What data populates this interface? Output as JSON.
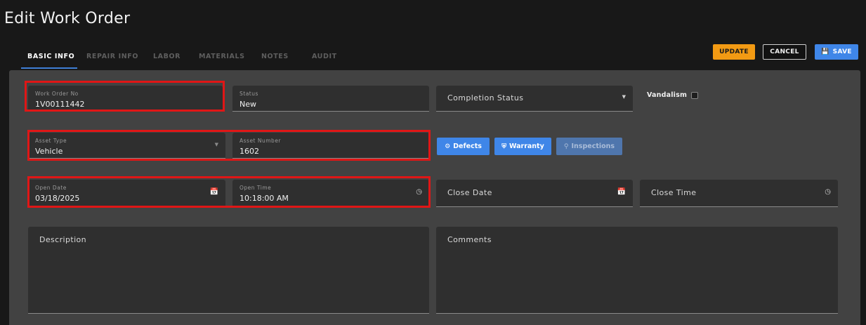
{
  "header": {
    "title": "Edit Work Order"
  },
  "tabs": [
    {
      "label": "BASIC INFO"
    },
    {
      "label": "REPAIR INFO"
    },
    {
      "label": "LABOR"
    },
    {
      "label": "MATERIALS"
    },
    {
      "label": "NOTES"
    },
    {
      "label": "AUDIT"
    }
  ],
  "actions": {
    "update": "UPDATE",
    "cancel": "CANCEL",
    "save": "SAVE"
  },
  "colors": {
    "accent": "#3f86e8",
    "update": "#f29a13",
    "highlight": "#e01616"
  },
  "fields": {
    "work_order_no": {
      "label": "Work Order No",
      "value": "1V00111442"
    },
    "status": {
      "label": "Status",
      "value": "New"
    },
    "completion_status": {
      "placeholder": "Completion Status"
    },
    "vandalism": {
      "label": "Vandalism",
      "checked": false
    },
    "asset_type": {
      "label": "Asset Type",
      "value": "Vehicle"
    },
    "asset_number": {
      "label": "Asset Number",
      "value": "1602"
    },
    "open_date": {
      "label": "Open Date",
      "value": "03/18/2025"
    },
    "open_time": {
      "label": "Open Time",
      "value": "10:18:00 AM"
    },
    "close_date": {
      "placeholder": "Close Date"
    },
    "close_time": {
      "placeholder": "Close Time"
    },
    "description": {
      "placeholder": "Description"
    },
    "comments": {
      "placeholder": "Comments"
    }
  },
  "buttons": {
    "defects": "Defects",
    "warranty": "Warranty",
    "inspections": "Inspections"
  },
  "icons": [
    "dropdown-arrow-icon",
    "calendar-icon",
    "clock-icon",
    "gear-icon",
    "shield-icon",
    "search-icon",
    "save-icon"
  ]
}
